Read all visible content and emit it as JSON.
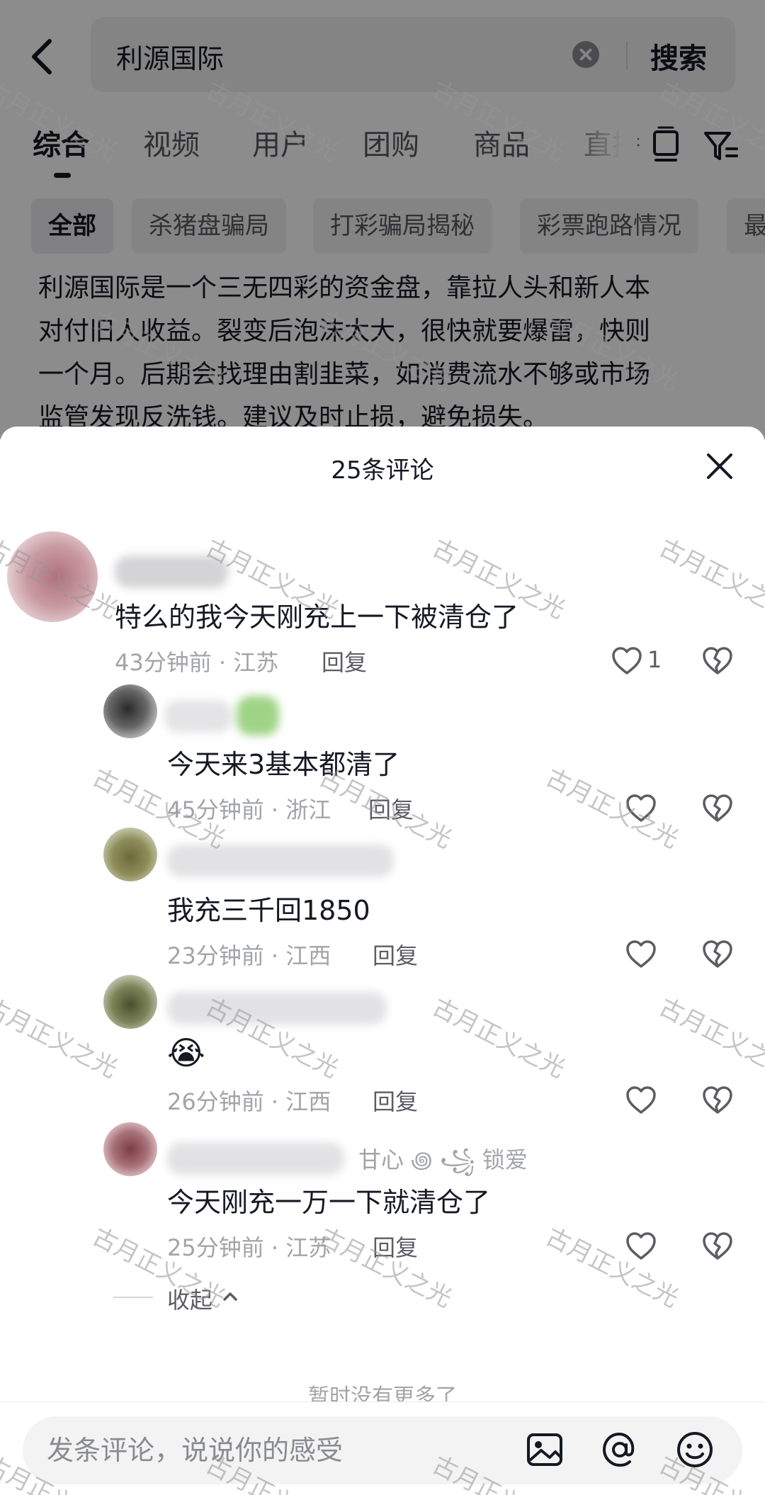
{
  "search": {
    "query": "利源国际",
    "button_label": "搜索"
  },
  "tabs": [
    "综合",
    "视频",
    "用户",
    "团购",
    "商品",
    "直播"
  ],
  "chips": [
    "全部",
    "杀猪盘骗局",
    "打彩骗局揭秘",
    "彩票跑路情况",
    "最"
  ],
  "summary_lines": [
    "利源国际是一个三无四彩的资金盘，靠拉人头和新人本",
    "对付旧人收益。裂变后泡沫太大，很快就要爆雷，快则",
    "一个月。后期会找理由割韭菜，如消费流水不够或市场",
    "监管发现反洗钱。建议及时止损，避免损失。"
  ],
  "comments": {
    "title": "25条评论",
    "items": [
      {
        "text": "特么的我今天刚充上一下被清仓了",
        "time": "43分钟前",
        "location": "江苏",
        "reply": "回复",
        "likes": "1"
      },
      {
        "text": "今天来3基本都清了",
        "time": "45分钟前",
        "location": "浙江",
        "reply": "回复"
      },
      {
        "text": "我充三千回1850",
        "time": "23分钟前",
        "location": "江西",
        "reply": "回复"
      },
      {
        "text": "😭",
        "time": "26分钟前",
        "location": "江西",
        "reply": "回复"
      },
      {
        "text": "今天刚充一万一下就清仓了",
        "time": "25分钟前",
        "location": "江苏",
        "reply": "回复",
        "author_tail": "甘心 ꩜ ꧁ 锁爱"
      }
    ],
    "collapse_label": "收起",
    "no_more": "暂时没有更多了"
  },
  "input": {
    "placeholder": "发条评论，说说你的感受"
  },
  "watermark": "古月正义之光",
  "icons": {
    "back": "back-arrow-icon",
    "clear": "clear-icon",
    "close": "close-icon",
    "like": "heart-icon",
    "dislike": "broken-heart-icon",
    "image": "image-icon",
    "mention": "at-icon",
    "emoji": "emoji-icon"
  }
}
